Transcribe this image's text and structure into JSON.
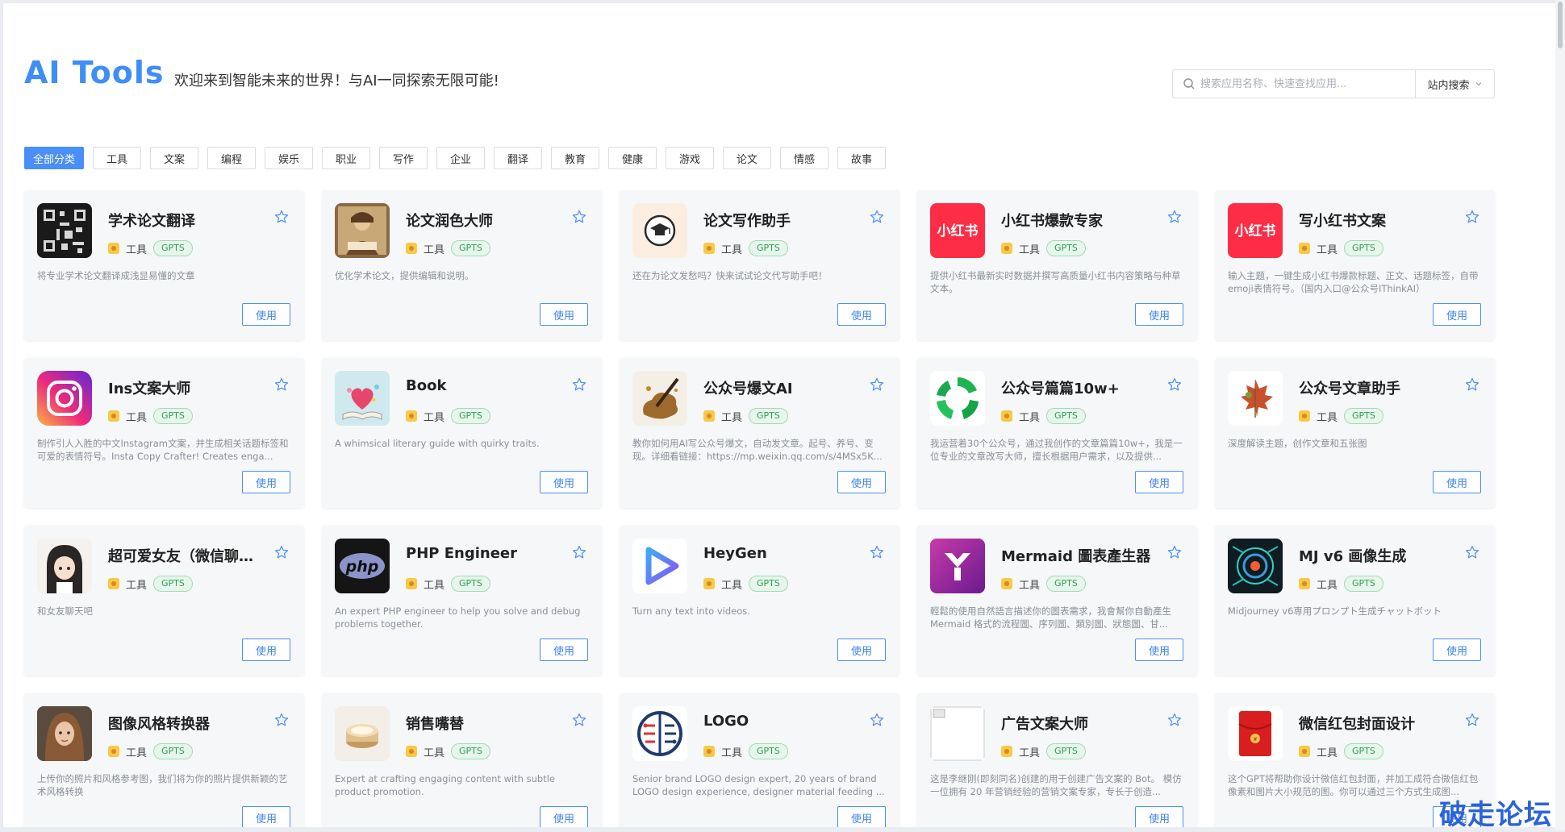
{
  "header": {
    "brand": "AI Tools",
    "tagline": "欢迎来到智能未来的世界！与AI一同探索无限可能!",
    "search": {
      "placeholder": "搜索应用名称、快速查找应用...",
      "scope_label": "站内搜索"
    }
  },
  "categories": [
    {
      "label": "全部分类",
      "active": true
    },
    {
      "label": "工具"
    },
    {
      "label": "文案"
    },
    {
      "label": "编程"
    },
    {
      "label": "娱乐"
    },
    {
      "label": "职业"
    },
    {
      "label": "写作"
    },
    {
      "label": "企业"
    },
    {
      "label": "翻译"
    },
    {
      "label": "教育"
    },
    {
      "label": "健康"
    },
    {
      "label": "游戏"
    },
    {
      "label": "论文"
    },
    {
      "label": "情感"
    },
    {
      "label": "故事"
    }
  ],
  "cards": [
    {
      "title": "学术论文翻译",
      "category": "工具",
      "badge": "GPTS",
      "desc": "将专业学术论文翻译成浅显易懂的文章",
      "button": "使用",
      "icon": "qr-pattern-icon"
    },
    {
      "title": "论文润色大师",
      "category": "工具",
      "badge": "GPTS",
      "desc": "优化学术论文，提供编辑和说明。",
      "button": "使用",
      "icon": "scholar-portrait-icon"
    },
    {
      "title": "论文写作助手",
      "category": "工具",
      "badge": "GPTS",
      "desc": "还在为论文发愁吗？快来试试论文代写助手吧！",
      "button": "使用",
      "icon": "graduation-cap-icon"
    },
    {
      "title": "小红书爆款专家",
      "category": "工具",
      "badge": "GPTS",
      "desc": "提供小红书最新实时数据并撰写高质量小红书内容策略与种草文本。",
      "button": "使用",
      "icon": "xiaohongshu-logo-icon",
      "logo_text": "小红书"
    },
    {
      "title": "写小红书文案",
      "category": "工具",
      "badge": "GPTS",
      "desc": "输入主题，一键生成小红书爆款标题、正文、话题标签，自带emoji表情符号。（国内入口@公众号IThinkAI）",
      "button": "使用",
      "icon": "xiaohongshu-logo-icon",
      "logo_text": "小红书"
    },
    {
      "title": "Ins文案大师",
      "category": "工具",
      "badge": "GPTS",
      "desc": "制作引人入胜的中文Instagram文案，并生成相关话题标签和可爱的表情符号。Insta Copy Crafter! Creates enga...",
      "button": "使用",
      "icon": "instagram-logo-icon"
    },
    {
      "title": "Book",
      "category": "工具",
      "badge": "GPTS",
      "desc": "A whimsical literary guide with quirky traits.",
      "button": "使用",
      "icon": "heart-book-icon"
    },
    {
      "title": "公众号爆文AI",
      "category": "工具",
      "badge": "GPTS",
      "desc": "教你如何用AI写公众号爆文，自动发文章。起号、养号、变现。详细看链接：https://mp.weixin.qq.com/s/4MSx5K...",
      "button": "使用",
      "icon": "paint-splash-icon"
    },
    {
      "title": "公众号篇篇10w+",
      "category": "工具",
      "badge": "GPTS",
      "desc": "我运营着30个公众号，通过我创作的文章篇篇10w+，我是一位专业的文章改写大师，擅长根据用户需求，以及提供...",
      "button": "使用",
      "icon": "green-swirl-icon"
    },
    {
      "title": "公众号文章助手",
      "category": "工具",
      "badge": "GPTS",
      "desc": "深度解读主题，创作文章和五张图",
      "button": "使用",
      "icon": "maple-leaf-icon"
    },
    {
      "title": "超可爱女友（微信聊天...",
      "category": "工具",
      "badge": "GPTS",
      "desc": "和女友聊天吧",
      "button": "使用",
      "icon": "anime-girl-icon"
    },
    {
      "title": "PHP Engineer",
      "category": "工具",
      "badge": "GPTS",
      "desc": "An expert PHP engineer to help you solve and debug problems together.",
      "button": "使用",
      "icon": "php-logo-icon",
      "logo_text": "php"
    },
    {
      "title": "HeyGen",
      "category": "工具",
      "badge": "GPTS",
      "desc": "Turn any text into videos.",
      "button": "使用",
      "icon": "play-logo-icon"
    },
    {
      "title": "Mermaid 圖表產生器",
      "category": "工具",
      "badge": "GPTS",
      "desc": "輕鬆的使用自然語言描述你的圖表需求，我會幫你自動產生 Mermaid 格式的流程圖、序列圖、類別圖、狀態圖、甘...",
      "button": "使用",
      "icon": "y-logo-icon"
    },
    {
      "title": "MJ v6 画像生成",
      "category": "工具",
      "badge": "GPTS",
      "desc": "Midjourney v6専用プロンプト生成チャットボット",
      "button": "使用",
      "icon": "cyber-eye-icon"
    },
    {
      "title": "图像风格转换器",
      "category": "工具",
      "badge": "GPTS",
      "desc": "上传你的照片和风格参考图，我们将为你的照片提供新颖的艺术风格转换",
      "button": "使用",
      "icon": "portrait-photo-icon"
    },
    {
      "title": "销售嘴替",
      "category": "工具",
      "badge": "GPTS",
      "desc": "Expert at crafting engaging content with subtle product promotion.",
      "button": "使用",
      "icon": "cream-jar-icon"
    },
    {
      "title": "LOGO",
      "category": "工具",
      "badge": "GPTS",
      "desc": "Senior brand LOGO design expert, 20 years of brand LOGO design experience, designer material feeding ...",
      "button": "使用",
      "icon": "brain-logo-icon"
    },
    {
      "title": "广告文案大师",
      "category": "工具",
      "badge": "GPTS",
      "desc": "这是李继刚(即刻同名)创建的用于创建广告文案的 Bot。 模仿一位拥有 20 年营销经验的营销文案专家，专长于创造...",
      "button": "使用",
      "icon": "broken-image-icon"
    },
    {
      "title": "微信红包封面设计",
      "category": "工具",
      "badge": "GPTS",
      "desc": "这个GPT将帮助你设计微信红包封面，并加工成符合微信红包像素和图片大小规范的图。你可以通过三个方式生成图...",
      "button": "使用",
      "icon": "red-envelope-icon"
    }
  ],
  "watermark": "破走论坛",
  "colors": {
    "accent": "#4a8ff7",
    "brand": "#3f8ef5",
    "gpts_green": "#2f9e52",
    "card_bg": "#f6f7f9"
  }
}
